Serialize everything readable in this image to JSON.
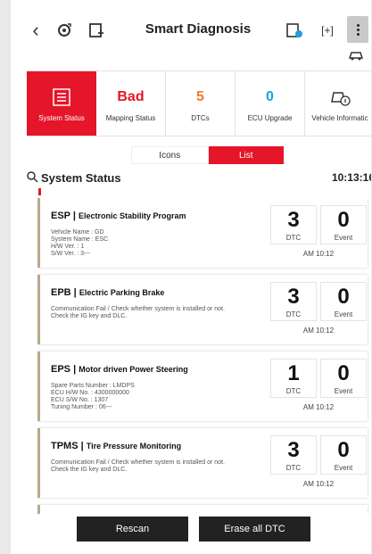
{
  "header": {
    "title": "Smart Diagnosis",
    "back_icon": "chevron-left-icon",
    "right_scan_label": "[+]"
  },
  "tabs": [
    {
      "value": "",
      "label": "System Status",
      "icon": "list-icon",
      "active": true
    },
    {
      "value": "Bad",
      "label": "Mapping Status",
      "color": "#e5152a"
    },
    {
      "value": "5",
      "label": "DTCs",
      "color": "#f07a2e"
    },
    {
      "value": "0",
      "label": "ECU Upgrade",
      "color": "#1f9fdc"
    },
    {
      "value": "",
      "label": "Vehicle Informatic",
      "icon": "car-info-icon"
    }
  ],
  "view_toggle": {
    "icons": "Icons",
    "list": "List",
    "selected": "List"
  },
  "section": {
    "title": "System Status",
    "time": "10:13:16"
  },
  "systems": [
    {
      "code": "ESP",
      "name": "Electronic Stability Program",
      "details": [
        "Vehicle Name : GD",
        "System Name : ESC",
        "H/W Ver. : 1",
        "S/W Ver. : 3---"
      ],
      "dtc": "3",
      "event": "0",
      "time": "AM 10:12"
    },
    {
      "code": "EPB",
      "name": "Electric Parking Brake",
      "details": [
        "Communication Fail / Check whether system is installed or not.",
        "Check the IG key and DLC."
      ],
      "dtc": "3",
      "event": "0",
      "time": "AM 10:12"
    },
    {
      "code": "EPS",
      "name": "Motor driven Power Steering",
      "details": [
        "Spare Parts Number : LMDPS",
        "ECU H/W No. : 4300000000",
        "ECU S/W No. : 1307",
        "Tuning Number : 06---"
      ],
      "dtc": "1",
      "event": "0",
      "time": "AM 10:12"
    },
    {
      "code": "TPMS",
      "name": "Tire Pressure Monitoring",
      "details": [
        "Communication Fail / Check whether system is installed or not.",
        "Check the IG key and DLC."
      ],
      "dtc": "3",
      "event": "0",
      "time": "AM 10:12"
    }
  ],
  "labels": {
    "dtc": "DTC",
    "event": "Event"
  },
  "buttons": {
    "rescan": "Rescan",
    "erase": "Erase all DTC"
  },
  "colors": {
    "accent": "#e5152a",
    "card_border": "#b7a98a"
  }
}
